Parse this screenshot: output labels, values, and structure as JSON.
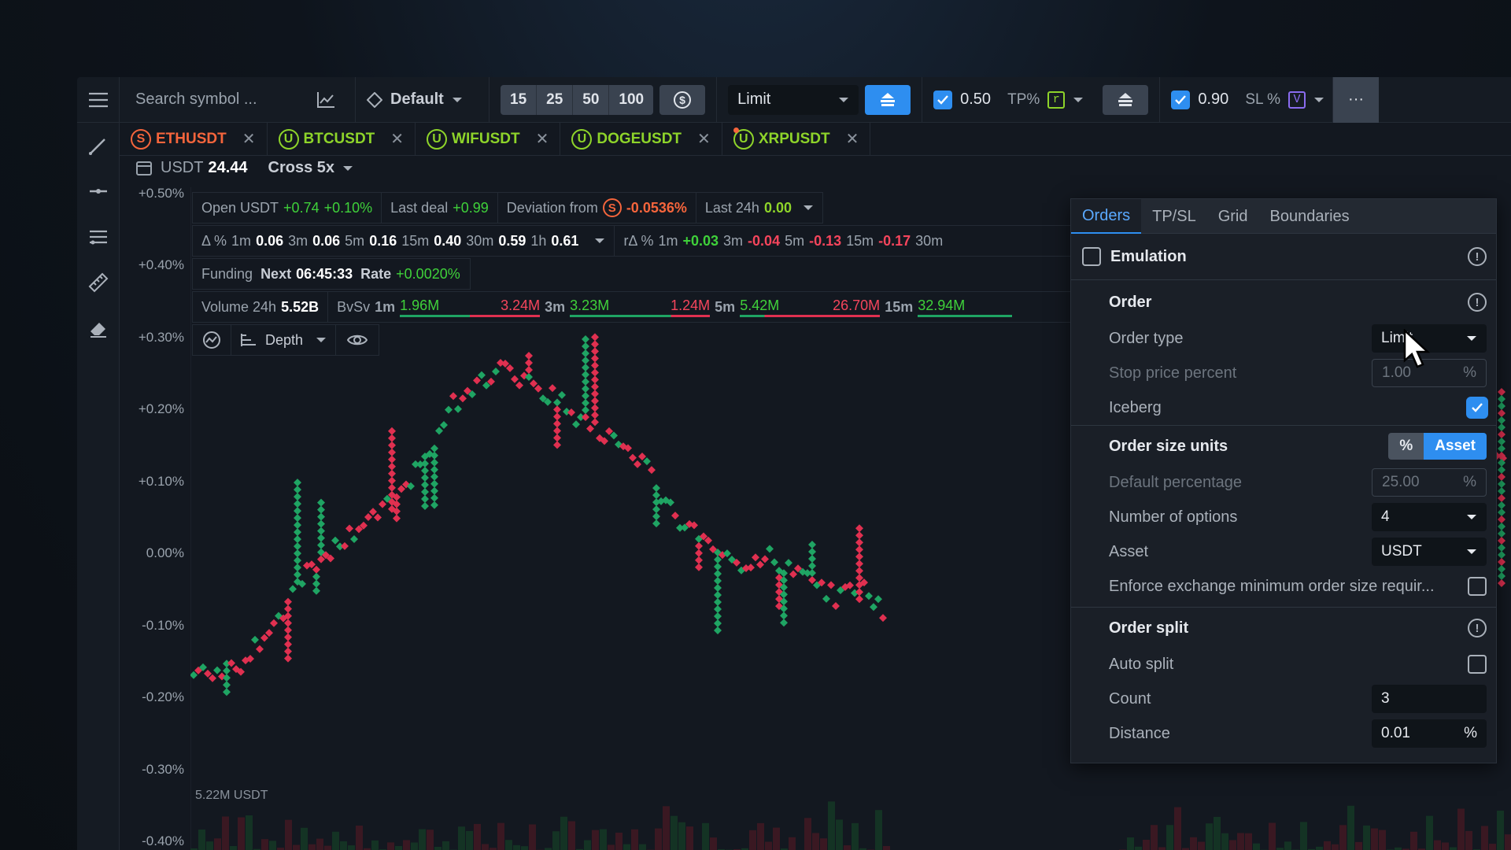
{
  "toolbar": {
    "search_placeholder": "Search symbol ...",
    "preset": "Default",
    "quantities": [
      "15",
      "25",
      "50",
      "100"
    ],
    "order_type": "Limit",
    "tp_value": "0.50",
    "tp_label": "TP%",
    "tp_badge": "r",
    "sl_value": "0.90",
    "sl_label": "SL %",
    "sl_badge": "V",
    "more": "···"
  },
  "tabs": [
    {
      "symbol": "ETHUSDT",
      "coin": "S",
      "color": "#f5653c"
    },
    {
      "symbol": "BTCUSDT",
      "coin": "U",
      "color": "#8ed42a"
    },
    {
      "symbol": "WIFUSDT",
      "coin": "U",
      "color": "#8ed42a"
    },
    {
      "symbol": "DOGEUSDT",
      "coin": "U",
      "color": "#8ed42a"
    },
    {
      "symbol": "XRPUSDT",
      "coin": "U",
      "color": "#8ed42a"
    }
  ],
  "account": {
    "currency": "USDT",
    "balance": "24.44",
    "margin": "Cross 5x"
  },
  "stats": {
    "open_label": "Open USDT",
    "open_value": "+0.74",
    "open_pct": "+0.10%",
    "last_deal_label": "Last deal",
    "last_deal_value": "+0.99",
    "deviation_label": "Deviation from",
    "deviation_value": "-0.0536%",
    "last24_label": "Last 24h",
    "last24_value": "0.00"
  },
  "deltas": {
    "label": "Δ %",
    "items": [
      {
        "tf": "1m",
        "v": "0.06"
      },
      {
        "tf": "3m",
        "v": "0.06"
      },
      {
        "tf": "5m",
        "v": "0.16"
      },
      {
        "tf": "15m",
        "v": "0.40"
      },
      {
        "tf": "30m",
        "v": "0.59"
      },
      {
        "tf": "1h",
        "v": "0.61"
      }
    ],
    "rlabel": "rΔ %",
    "ritems": [
      {
        "tf": "1m",
        "v": "+0.03"
      },
      {
        "tf": "3m",
        "v": "-0.04"
      },
      {
        "tf": "5m",
        "v": "-0.13"
      },
      {
        "tf": "15m",
        "v": "-0.17"
      },
      {
        "tf": "30m",
        "v": ""
      }
    ]
  },
  "funding": {
    "label": "Funding",
    "next_label": "Next",
    "next_value": "06:45:33",
    "rate_label": "Rate",
    "rate_value": "+0.0020%"
  },
  "volume": {
    "label": "Volume 24h",
    "value": "5.52B",
    "bvsv": "BvSv",
    "items": [
      {
        "tf": "1m",
        "buy": "1.96M",
        "sell": "3.24M"
      },
      {
        "tf": "3m",
        "buy": "3.23M",
        "sell": "1.24M"
      },
      {
        "tf": "5m",
        "buy": "5.42M",
        "sell": "26.70M"
      },
      {
        "tf": "15m",
        "buy": "32.94M",
        "sell": ""
      }
    ]
  },
  "chart_tools": {
    "depth": "Depth"
  },
  "yaxis": [
    "+0.50%",
    "+0.40%",
    "+0.30%",
    "+0.20%",
    "+0.10%",
    "0.00%",
    "-0.10%",
    "-0.20%",
    "-0.30%",
    "-0.40%"
  ],
  "chart_volume_label": "5.22M USDT",
  "panel": {
    "tabs": [
      "Orders",
      "TP/SL",
      "Grid",
      "Boundaries"
    ],
    "emulation": "Emulation",
    "order_title": "Order",
    "order_type_label": "Order type",
    "order_type_value": "Limit",
    "stop_label": "Stop price percent",
    "stop_value": "1.00",
    "iceberg_label": "Iceberg",
    "size_units_label": "Order size units",
    "size_units_options": [
      "%",
      "Asset"
    ],
    "default_pct_label": "Default percentage",
    "default_pct_value": "25.00",
    "num_options_label": "Number of options",
    "num_options_value": "4",
    "asset_label": "Asset",
    "asset_value": "USDT",
    "enforce_label": "Enforce exchange minimum order size requir...",
    "split_title": "Order split",
    "auto_split_label": "Auto split",
    "count_label": "Count",
    "count_value": "3",
    "distance_label": "Distance",
    "distance_value": "0.01",
    "pct": "%"
  },
  "colors": {
    "buy": "#1fa463",
    "sell": "#e03050",
    "accent": "#2e8ef0"
  }
}
